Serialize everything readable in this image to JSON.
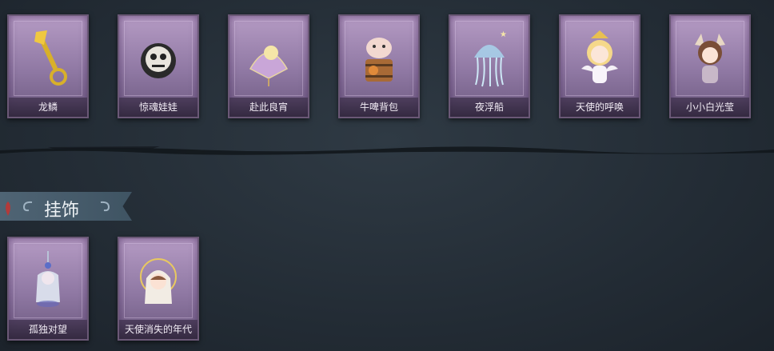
{
  "top_items": [
    {
      "label": "龙鳞",
      "icon": "golden-shovel-icon"
    },
    {
      "label": "惊魂娃娃",
      "icon": "skull-doll-icon"
    },
    {
      "label": "赴此良宵",
      "icon": "fan-moon-icon"
    },
    {
      "label": "牛啤背包",
      "icon": "cow-beer-backpack-icon"
    },
    {
      "label": "夜浮船",
      "icon": "jellyfish-ship-icon"
    },
    {
      "label": "天使的呼唤",
      "icon": "angel-chibi-icon"
    },
    {
      "label": "小小白光莹",
      "icon": "white-light-chibi-icon"
    }
  ],
  "section": {
    "title": "挂饰"
  },
  "bottom_items": [
    {
      "label": "孤独对望",
      "icon": "lonely-figure-pendant-icon"
    },
    {
      "label": "天使消失的年代",
      "icon": "halo-girl-pendant-icon"
    }
  ],
  "colors": {
    "card": "#9a84ad",
    "background": "#262f38",
    "banner": "#4a5f6f"
  }
}
